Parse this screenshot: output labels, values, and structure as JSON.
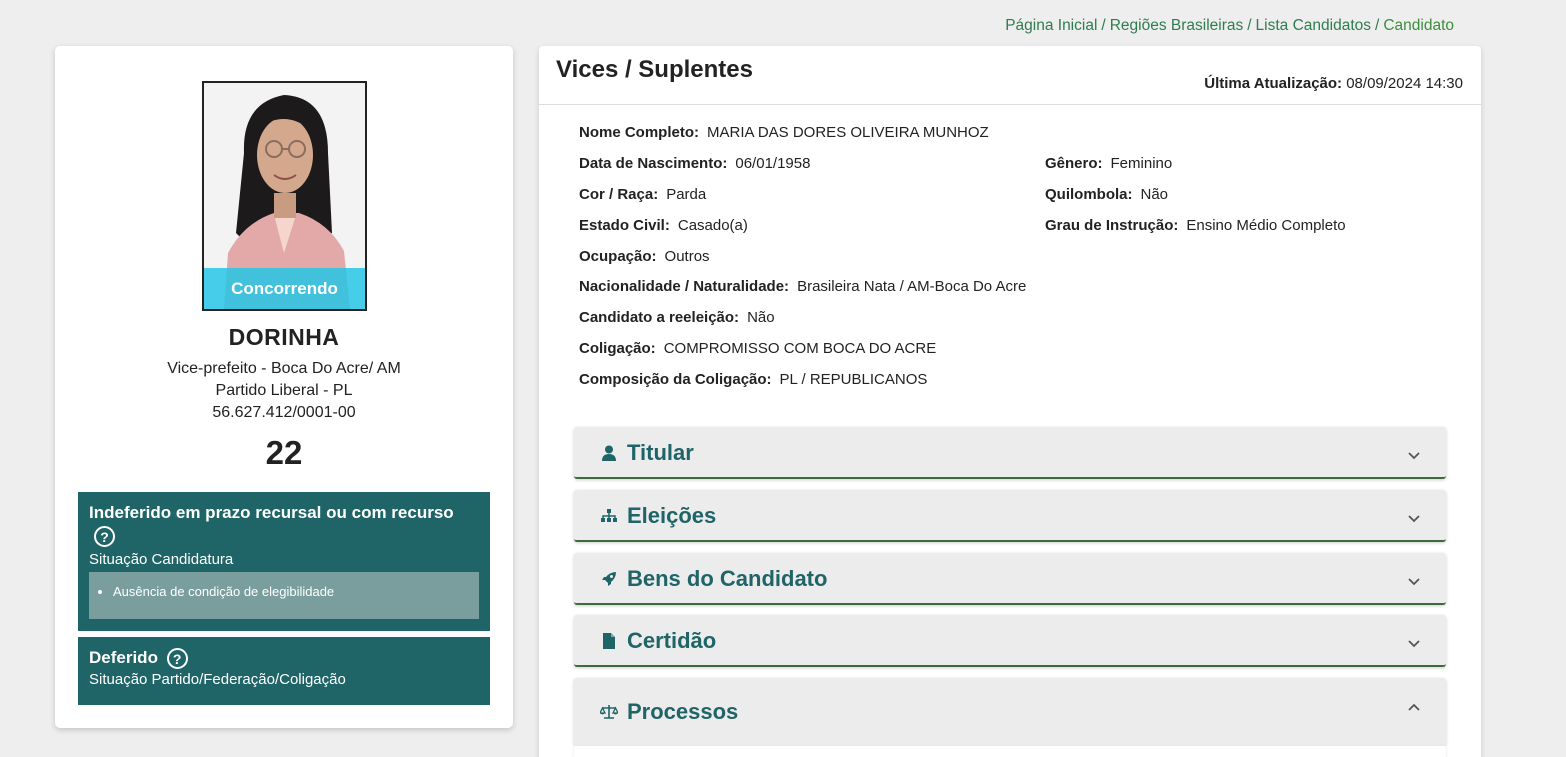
{
  "breadcrumb": {
    "items": [
      "Página Inicial",
      "Regiões Brasileiras",
      "Lista Candidatos"
    ],
    "current": "Candidato",
    "separator": "/"
  },
  "candidate": {
    "status_overlay": "Concorrendo",
    "name": "DORINHA",
    "role": "Vice-prefeito - Boca Do Acre/ AM",
    "party": "Partido Liberal - PL",
    "cnpj": "56.627.412/0001-00",
    "number": "22"
  },
  "candidacy_status": {
    "title": "Indeferido em prazo recursal ou com recurso",
    "help_icon": "?",
    "label": "Situação Candidatura",
    "reasons": [
      "Ausência de condição de elegibilidade"
    ]
  },
  "party_status": {
    "title": "Deferido",
    "help_icon": "?",
    "label": "Situação Partido/Federação/Coligação"
  },
  "panel": {
    "title": "Vices / Suplentes",
    "last_update_label": "Última Atualização:",
    "last_update_value": "08/09/2024 14:30"
  },
  "details": {
    "full_name": {
      "label": "Nome Completo:",
      "value": "MARIA DAS DORES OLIVEIRA MUNHOZ"
    },
    "birth_date": {
      "label": "Data de Nascimento:",
      "value": "06/01/1958"
    },
    "gender": {
      "label": "Gênero:",
      "value": "Feminino"
    },
    "race": {
      "label": "Cor / Raça:",
      "value": "Parda"
    },
    "quilombola": {
      "label": "Quilombola:",
      "value": "Não"
    },
    "marital_status": {
      "label": "Estado Civil:",
      "value": "Casado(a)"
    },
    "education": {
      "label": "Grau de Instrução:",
      "value": "Ensino Médio Completo"
    },
    "occupation": {
      "label": "Ocupação:",
      "value": "Outros"
    },
    "nationality": {
      "label": "Nacionalidade / Naturalidade:",
      "value": "Brasileira Nata / AM-Boca Do Acre"
    },
    "reelection": {
      "label": "Candidato a reeleição:",
      "value": "Não"
    },
    "coalition": {
      "label": "Coligação:",
      "value": "COMPROMISSO COM BOCA DO ACRE"
    },
    "coalition_composition": {
      "label": "Composição da Coligação:",
      "value": "PL / REPUBLICANOS"
    }
  },
  "accordions": [
    {
      "label": "Titular",
      "icon": "user-icon",
      "expanded": false
    },
    {
      "label": "Eleições",
      "icon": "sitemap-icon",
      "expanded": false
    },
    {
      "label": "Bens do Candidato",
      "icon": "rocket-icon",
      "expanded": false
    },
    {
      "label": "Certidão",
      "icon": "file-icon",
      "expanded": false
    },
    {
      "label": "Processos",
      "icon": "scale-balance-icon",
      "expanded": true
    }
  ],
  "colors": {
    "brand_teal": "#1f6466",
    "breadcrumb_green": "#2e7d4f",
    "status_overlay": "#26c6e6",
    "reason_box": "#7a9e9e"
  }
}
